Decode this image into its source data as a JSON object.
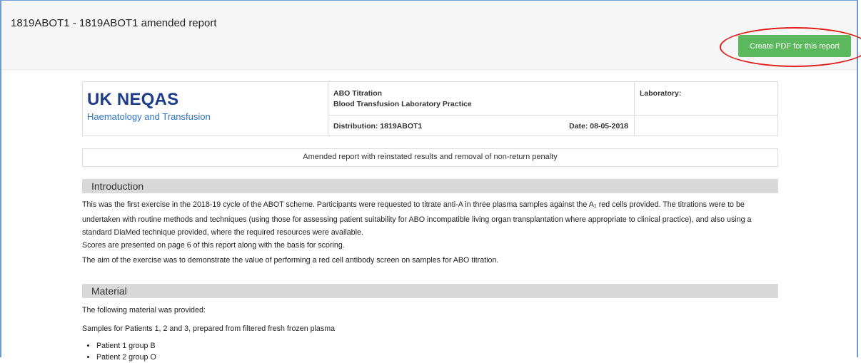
{
  "page": {
    "title": "1819ABOT1 - 1819ABOT1 amended report",
    "pdf_button_label": "Create PDF for this report"
  },
  "report_header": {
    "logo_main": "UK NEQAS",
    "logo_sub": "Haematology and Transfusion",
    "scheme_line1": "ABO Titration",
    "scheme_line2": "Blood Transfusion Laboratory Practice",
    "distribution": "Distribution: 1819ABOT1",
    "date": "Date: 08-05-2018",
    "laboratory_label": "Laboratory:"
  },
  "amend_notice": "Amended report with reinstated results and removal of non-return penalty",
  "introduction": {
    "heading": "Introduction",
    "p1_before_sub": "This was the first exercise in the 2018-19 cycle of the ABOT scheme. Participants were requested to titrate anti-A in three plasma samples against the A",
    "p1_sub": "1",
    "p1_after_sub": " red cells provided. The titrations were to be undertaken with routine methods and techniques (using those for assessing patient suitability for ABO incompatible living organ transplantation where appropriate to clinical practice), and also using a standard DiaMed technique provided, where the required resources were available.",
    "p1_scores": "Scores are presented on page 6 of this report along with the basis for scoring.",
    "p2": "The aim of the exercise was to demonstrate the value of performing a red cell antibody screen on samples for ABO titration."
  },
  "material": {
    "heading": "Material",
    "p1": "The following material was provided:",
    "p2": "Samples for Patients 1, 2 and 3, prepared from filtered fresh frozen plasma",
    "items": [
      "Patient 1 group B",
      "Patient 2 group O"
    ]
  },
  "colors": {
    "button_green": "#5cb85c",
    "highlight_ring": "#e0201b",
    "logo_blue": "#1c3c8c",
    "section_gray": "#d9d9d9"
  }
}
